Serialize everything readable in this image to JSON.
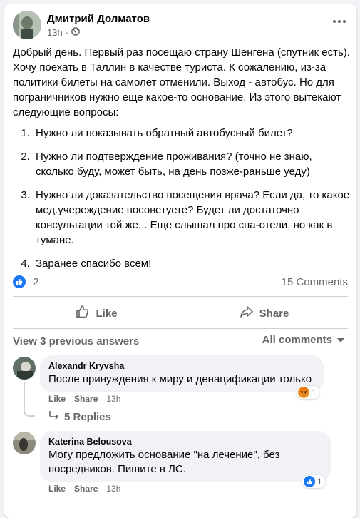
{
  "post": {
    "author": "Дмитрий Долматов",
    "time": "13h",
    "separator": "·",
    "privacy_icon": "globe-icon",
    "intro": "Добрый день. Первый раз посещаю страну Шенгена (спутник есть). Хочу поехать в Таллин в качестве туриста. К сожалению, из-за политики билеты на самолет отменили. Выход - автобус. Но для пограничников нужно еще какое-то основание. Из этого вытекают следующие вопросы:",
    "questions": [
      "Нужно ли показывать обратный автобусный билет?",
      "Нужно ли подтверждение проживания? (точно не знаю, сколько буду, может быть, на день позже-раньше уеду)",
      "Нужно ли доказательство посещения врача? Если да, то какое мед.учереждение посоветуете? Будет ли достаточно консультации той же... Еще слышал про спа-отели, но как в тумане.",
      "Заранее спасибо всем!"
    ],
    "reaction_count": "2",
    "comments_count": "15 Comments"
  },
  "actions": {
    "like": "Like",
    "share": "Share"
  },
  "comments_header": {
    "prev_answers": "View 3 previous answers",
    "filter": "All comments"
  },
  "comments": [
    {
      "author": "Alexandr Kryvsha",
      "text": "После принуждения к миру и денацификации только",
      "like": "Like",
      "share": "Share",
      "time": "13h",
      "reaction_count": "1",
      "reaction_icon": "angry-reaction-icon",
      "replies": "5 Replies"
    },
    {
      "author": "Katerina Belousova",
      "text": "Могу предложить основание \"на лечение\", без посредников. Пишите в ЛС.",
      "like": "Like",
      "share": "Share",
      "time": "13h",
      "reaction_count": "1",
      "reaction_icon": "like-reaction-icon"
    }
  ],
  "colors": {
    "accent": "#1877f2",
    "secondary_text": "#65676b",
    "bubble": "#f0f2f5",
    "angry": "#e9710f"
  }
}
